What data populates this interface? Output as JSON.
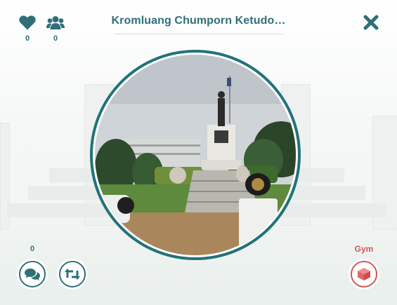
{
  "header": {
    "title": "Kromluang Chumporn Ketudo…",
    "likes": "0",
    "members": "0"
  },
  "footer": {
    "comment_count": "0",
    "gym_label": "Gym"
  },
  "colors": {
    "teal": "#2f7078",
    "ring": "#22727a",
    "gym_red": "#d15858"
  },
  "icons": {
    "likes": "heart-icon",
    "members": "users-icon",
    "close": "close-icon",
    "comment": "comments-icon",
    "swap": "retweet-icon",
    "gym": "cube-icon"
  }
}
